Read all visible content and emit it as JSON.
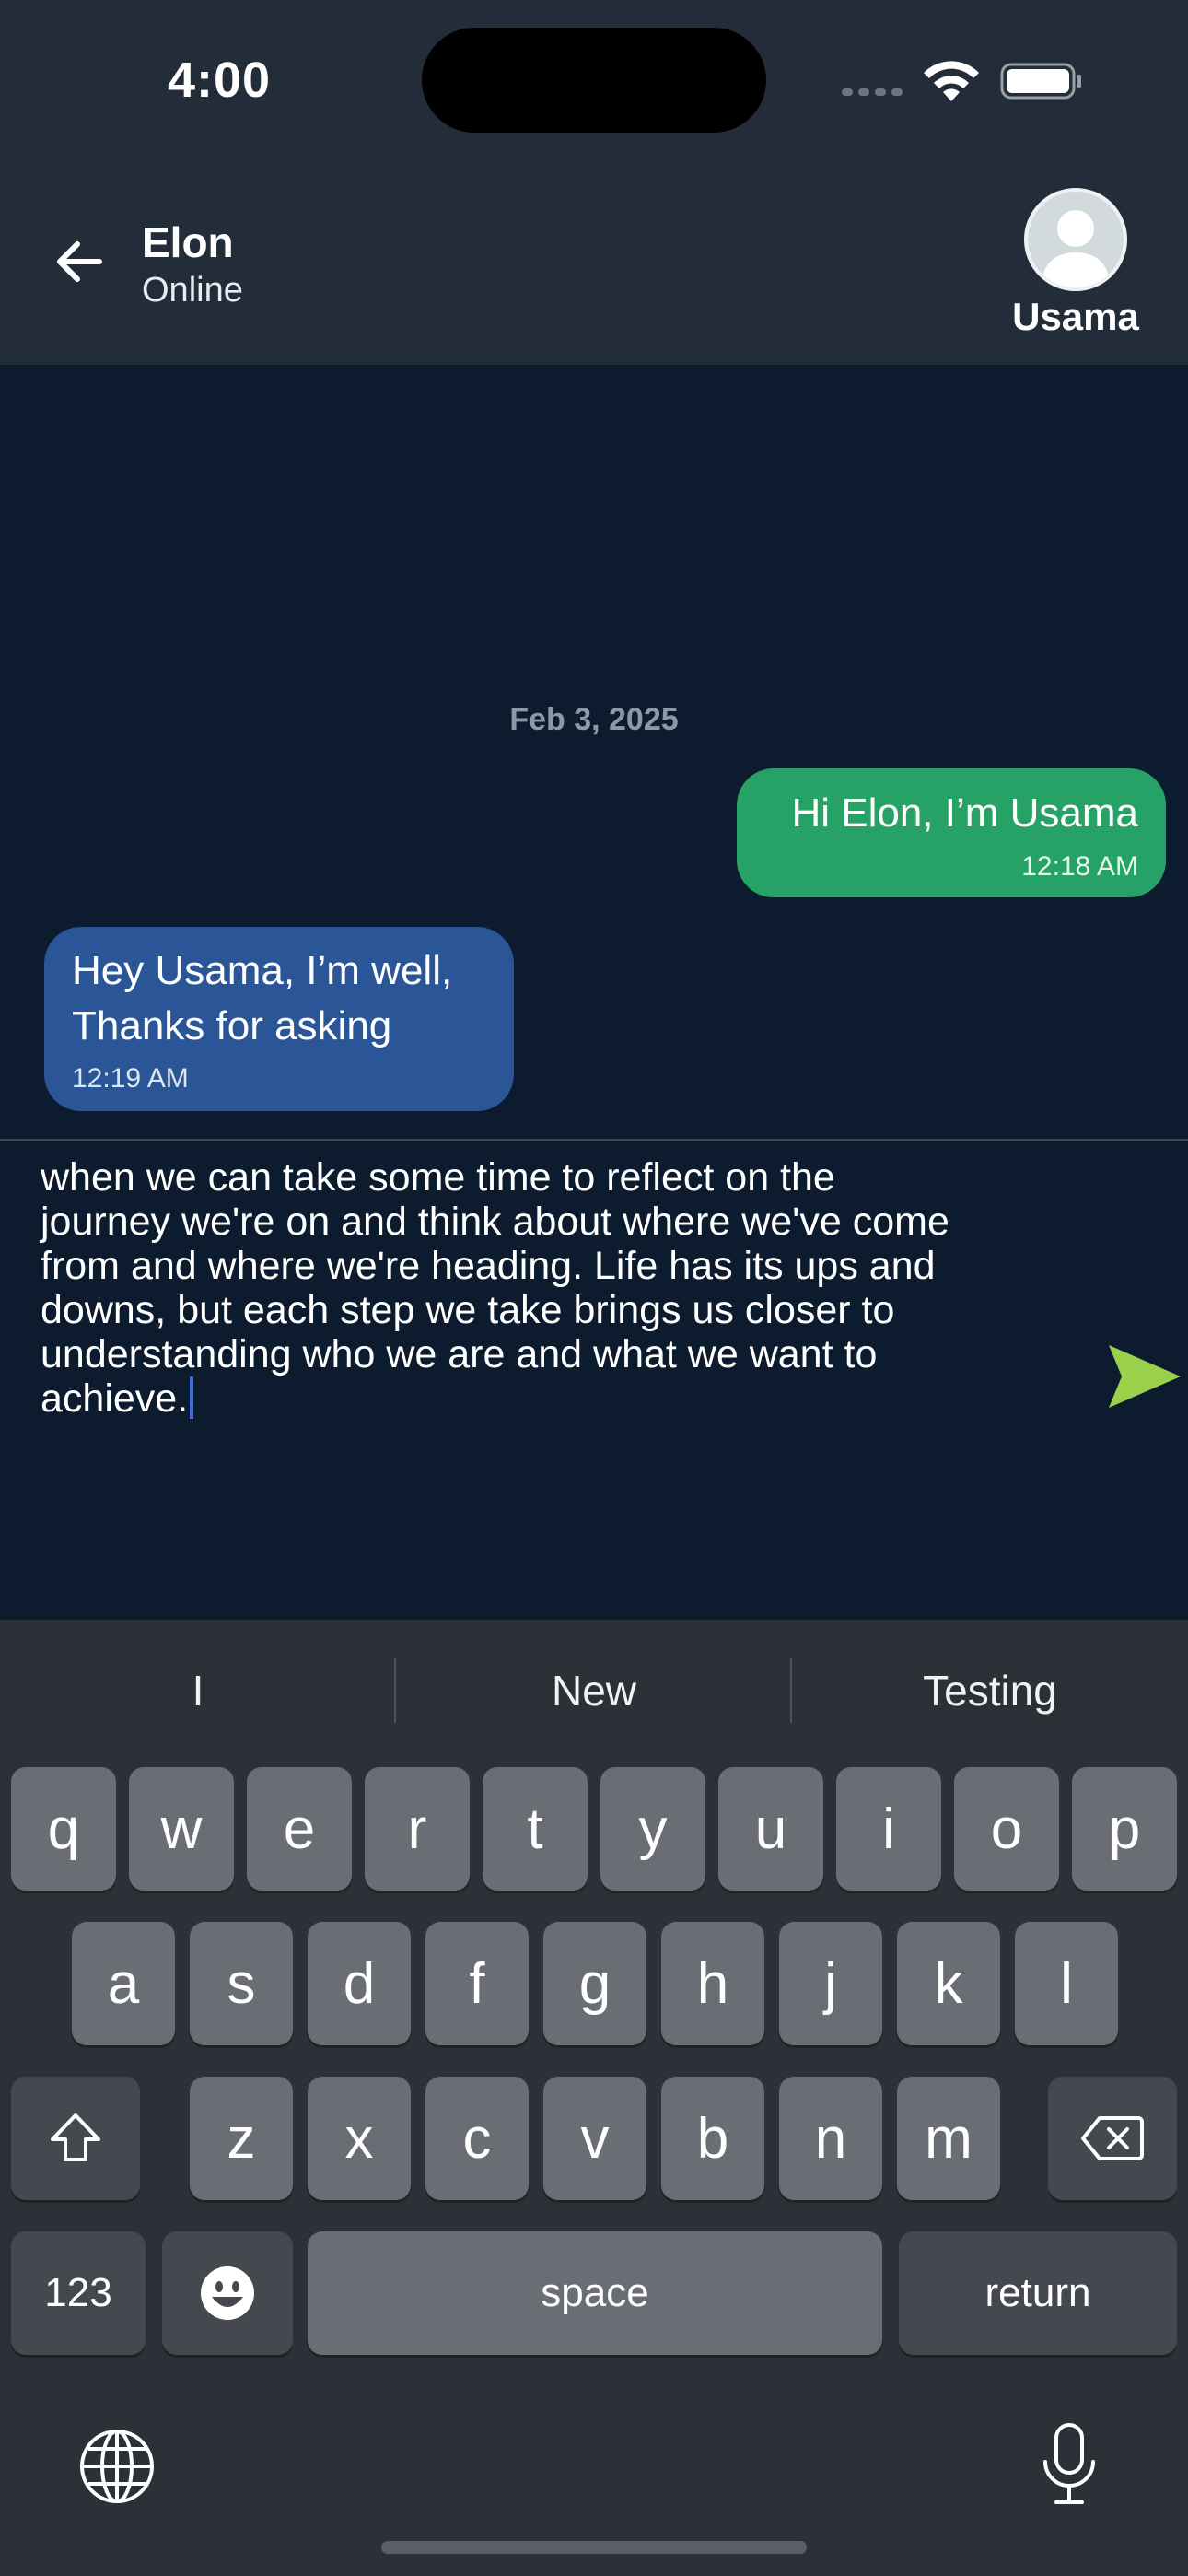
{
  "status_bar": {
    "time": "4:00",
    "icons": [
      "cellular-signal-icon",
      "wifi-icon",
      "battery-icon"
    ]
  },
  "header": {
    "back_icon": "arrow-left-icon",
    "contact_name": "Elon",
    "contact_status": "Online",
    "current_user_name": "Usama",
    "avatar_icon": "person-placeholder-icon"
  },
  "chat": {
    "date_separator": "Feb 3, 2025",
    "messages": [
      {
        "direction": "outgoing",
        "text": "Hi Elon, I’m Usama",
        "time": "12:18 AM"
      },
      {
        "direction": "incoming",
        "text": "Hey Usama, I’m well, Thanks for asking",
        "time": "12:19 AM"
      }
    ]
  },
  "composer": {
    "value": "when we can take some time to reflect on the\njourney we're on and think about where we've come\nfrom and where we're heading. Life has its ups and\ndowns, but each step we take brings us closer to\nunderstanding who we are and what we want to\nachieve.",
    "send_icon": "send-arrow-icon"
  },
  "keyboard": {
    "suggestions": [
      "I",
      "New",
      "Testing"
    ],
    "row1": [
      "q",
      "w",
      "e",
      "r",
      "t",
      "y",
      "u",
      "i",
      "o",
      "p"
    ],
    "row2": [
      "a",
      "s",
      "d",
      "f",
      "g",
      "h",
      "j",
      "k",
      "l"
    ],
    "row3": [
      "z",
      "x",
      "c",
      "v",
      "b",
      "n",
      "m"
    ],
    "numbers_label": "123",
    "space_label": "space",
    "return_label": "return"
  },
  "colors": {
    "background": "#0d1b2e",
    "header": "#232d3a",
    "outgoing_bubble": "#27a266",
    "incoming_bubble": "#2a5596",
    "send_accent": "#9ad14b",
    "keyboard": "#2c3138"
  }
}
